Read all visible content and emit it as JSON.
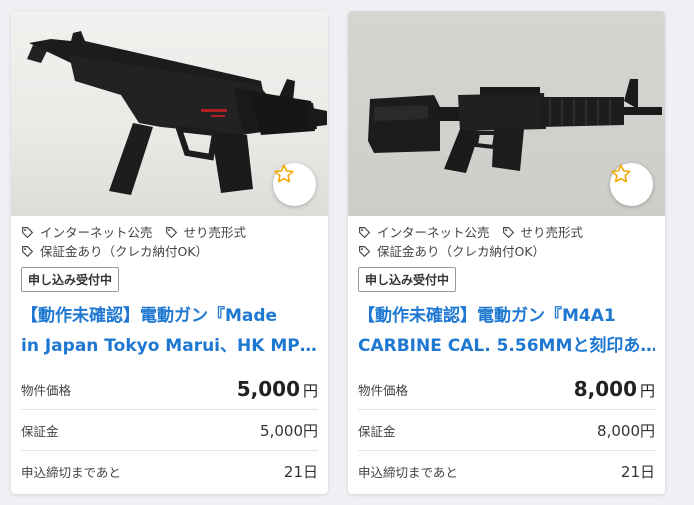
{
  "cards": [
    {
      "tags": [
        "インターネット公売",
        "せり売形式",
        "保証金あり（クレカ納付OK）"
      ],
      "status_badge": "申し込み受付中",
      "title_line1": "【動作未確認】電動ガン『Made",
      "title_line2": "in Japan Tokyo Marui、HK MP…",
      "price_label": "物件価格",
      "price_value": "5,000",
      "price_unit": "円",
      "deposit_label": "保証金",
      "deposit_value": "5,000円",
      "deadline_label": "申込締切まであと",
      "deadline_value": "21日",
      "image_icon": "submachine-gun-photo",
      "fav_icon": "star-outline-icon"
    },
    {
      "tags": [
        "インターネット公売",
        "せり売形式",
        "保証金あり（クレカ納付OK）"
      ],
      "status_badge": "申し込み受付中",
      "title_line1": "【動作未確認】電動ガン『M4A1",
      "title_line2": "CARBINE CAL. 5.56MMと刻印あ…",
      "price_label": "物件価格",
      "price_value": "8,000",
      "price_unit": "円",
      "deposit_label": "保証金",
      "deposit_value": "8,000円",
      "deadline_label": "申込締切まであと",
      "deadline_value": "21日",
      "image_icon": "carbine-rifle-photo",
      "fav_icon": "star-outline-icon"
    }
  ],
  "colors": {
    "title_link": "#1e78d2",
    "star": "#f0a800",
    "background": "#eef0f3"
  }
}
